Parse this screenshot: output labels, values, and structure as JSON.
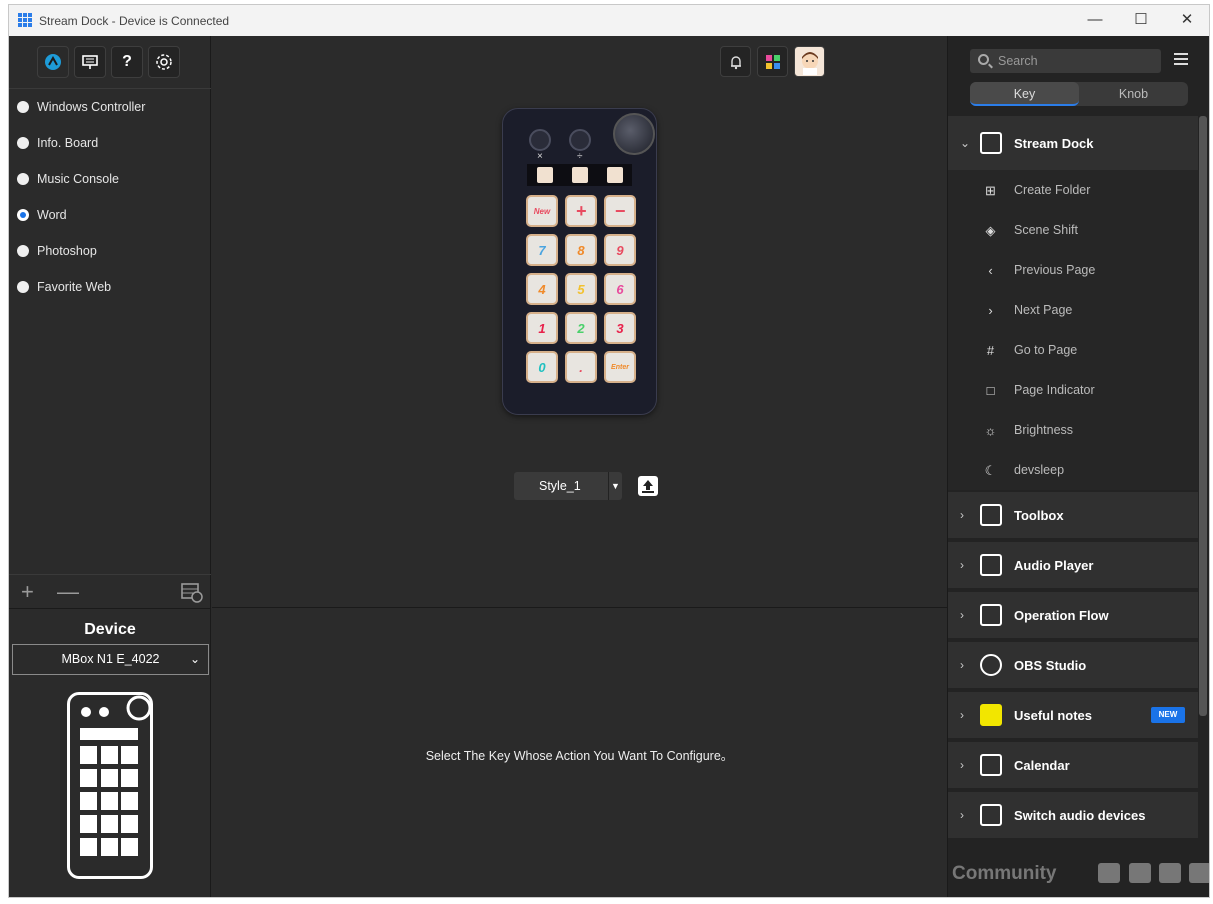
{
  "window": {
    "title": "Stream Dock - Device is Connected",
    "minimize": "—",
    "maximize": "☐",
    "close": "✕"
  },
  "toolbar": {
    "help_label": "?"
  },
  "profiles": [
    {
      "label": "Windows Controller",
      "selected": false
    },
    {
      "label": "Info. Board",
      "selected": false
    },
    {
      "label": "Music Console",
      "selected": false
    },
    {
      "label": "Word",
      "selected": true
    },
    {
      "label": "Photoshop",
      "selected": false
    },
    {
      "label": "Favorite Web",
      "selected": false
    }
  ],
  "profile_actions": {
    "add": "+",
    "remove": "—"
  },
  "device": {
    "heading": "Device",
    "selected": "MBox N1 E_4022"
  },
  "dock": {
    "knob_left_label": "×",
    "knob_mid_label": "÷",
    "keys": [
      "New",
      "+",
      "−",
      "7",
      "8",
      "9",
      "4",
      "5",
      "6",
      "1",
      "2",
      "3",
      "0",
      ".",
      "Enter"
    ]
  },
  "style": {
    "selected": "Style_1"
  },
  "hint": "Select The Key Whose Action You Want To Configure。",
  "right": {
    "search_placeholder": "Search",
    "tabs": [
      {
        "label": "Key",
        "active": true
      },
      {
        "label": "Knob",
        "active": false
      }
    ],
    "open_category": "Stream Dock",
    "actions": [
      {
        "label": "Create Folder",
        "icon": "⊞"
      },
      {
        "label": "Scene Shift",
        "icon": "◈"
      },
      {
        "label": "Previous Page",
        "icon": "‹"
      },
      {
        "label": "Next Page",
        "icon": "›"
      },
      {
        "label": "Go to Page",
        "icon": "#"
      },
      {
        "label": "Page Indicator",
        "icon": "□"
      },
      {
        "label": "Brightness",
        "icon": "☼"
      },
      {
        "label": "devsleep",
        "icon": "☾"
      }
    ],
    "categories": [
      {
        "label": "Toolbox"
      },
      {
        "label": "Audio Player"
      },
      {
        "label": "Operation Flow"
      },
      {
        "label": "OBS Studio"
      },
      {
        "label": "Useful notes",
        "badge": "NEW"
      },
      {
        "label": "Calendar"
      },
      {
        "label": "Switch audio devices"
      }
    ],
    "community_label": "Community"
  },
  "colors": {
    "accent": "#2b7de9",
    "background": "#2b2b2b",
    "panel": "#232323"
  }
}
